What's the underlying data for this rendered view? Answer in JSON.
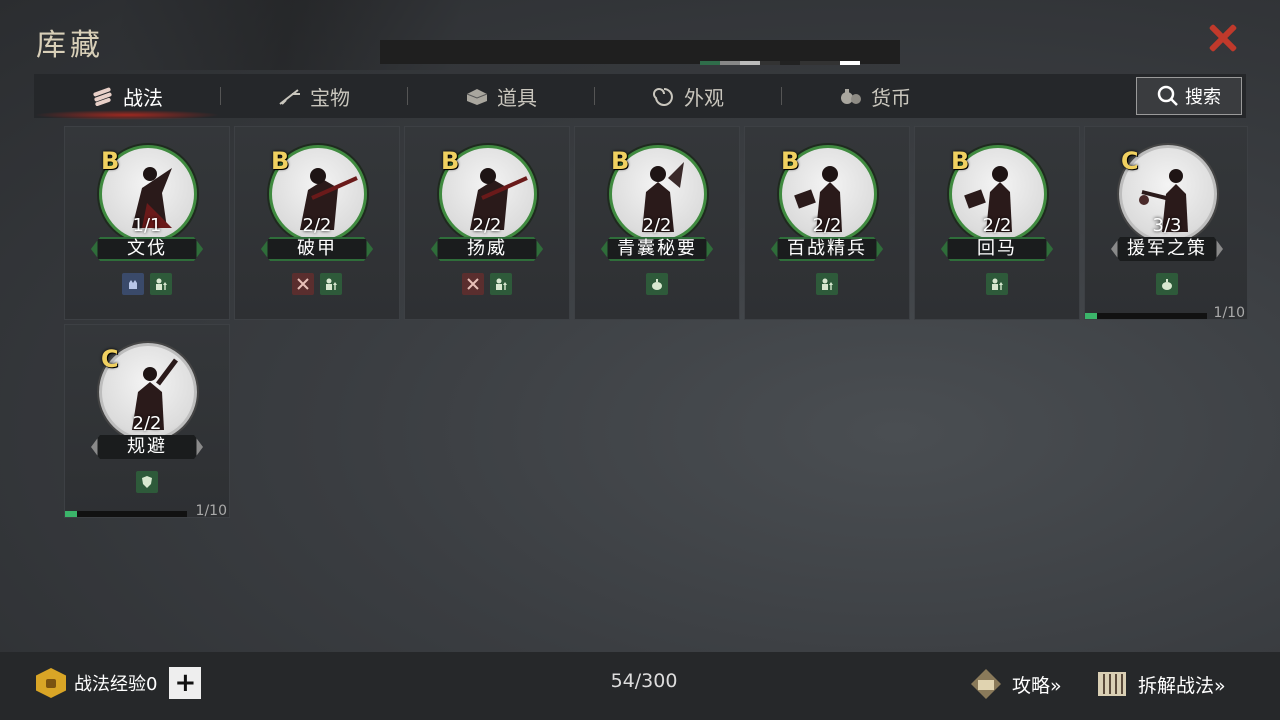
{
  "header": {
    "title": "库藏"
  },
  "tabs": [
    {
      "label": "战法",
      "icon": "scroll-bundle-icon",
      "active": true
    },
    {
      "label": "宝物",
      "icon": "weapon-icon",
      "active": false
    },
    {
      "label": "道具",
      "icon": "chest-icon",
      "active": false
    },
    {
      "label": "外观",
      "icon": "swirl-icon",
      "active": false
    },
    {
      "label": "货币",
      "icon": "money-bag-icon",
      "active": false
    }
  ],
  "search": {
    "label": "搜索"
  },
  "cards": [
    {
      "grade": "B",
      "count": "1/1",
      "name": "文伐",
      "tags": [
        "blue",
        "green"
      ]
    },
    {
      "grade": "B",
      "count": "2/2",
      "name": "破甲",
      "tags": [
        "red",
        "green"
      ]
    },
    {
      "grade": "B",
      "count": "2/2",
      "name": "扬威",
      "tags": [
        "red",
        "green"
      ]
    },
    {
      "grade": "B",
      "count": "2/2",
      "name": "青囊秘要",
      "tags": [
        "green"
      ]
    },
    {
      "grade": "B",
      "count": "2/2",
      "name": "百战精兵",
      "tags": [
        "green"
      ]
    },
    {
      "grade": "B",
      "count": "2/2",
      "name": "回马",
      "tags": [
        "green"
      ]
    },
    {
      "grade": "C",
      "count": "3/3",
      "name": "援军之策",
      "tags": [
        "green"
      ],
      "progress_text": "1/10",
      "progress": 0.1
    },
    {
      "grade": "C",
      "count": "2/2",
      "name": "规避",
      "tags": [
        "green"
      ],
      "progress_text": "1/10",
      "progress": 0.1
    }
  ],
  "footer": {
    "exp_label": "战法经验0",
    "plus_label": "+",
    "capacity": "54/300",
    "strategy_label": "攻略»",
    "disassemble_label": "拆解战法»"
  },
  "colors": {
    "accent_red": "#c0392b",
    "grade_gold": "#f0d060",
    "frame_green": "#3f8a3f",
    "progress_green": "#3bb56a"
  }
}
